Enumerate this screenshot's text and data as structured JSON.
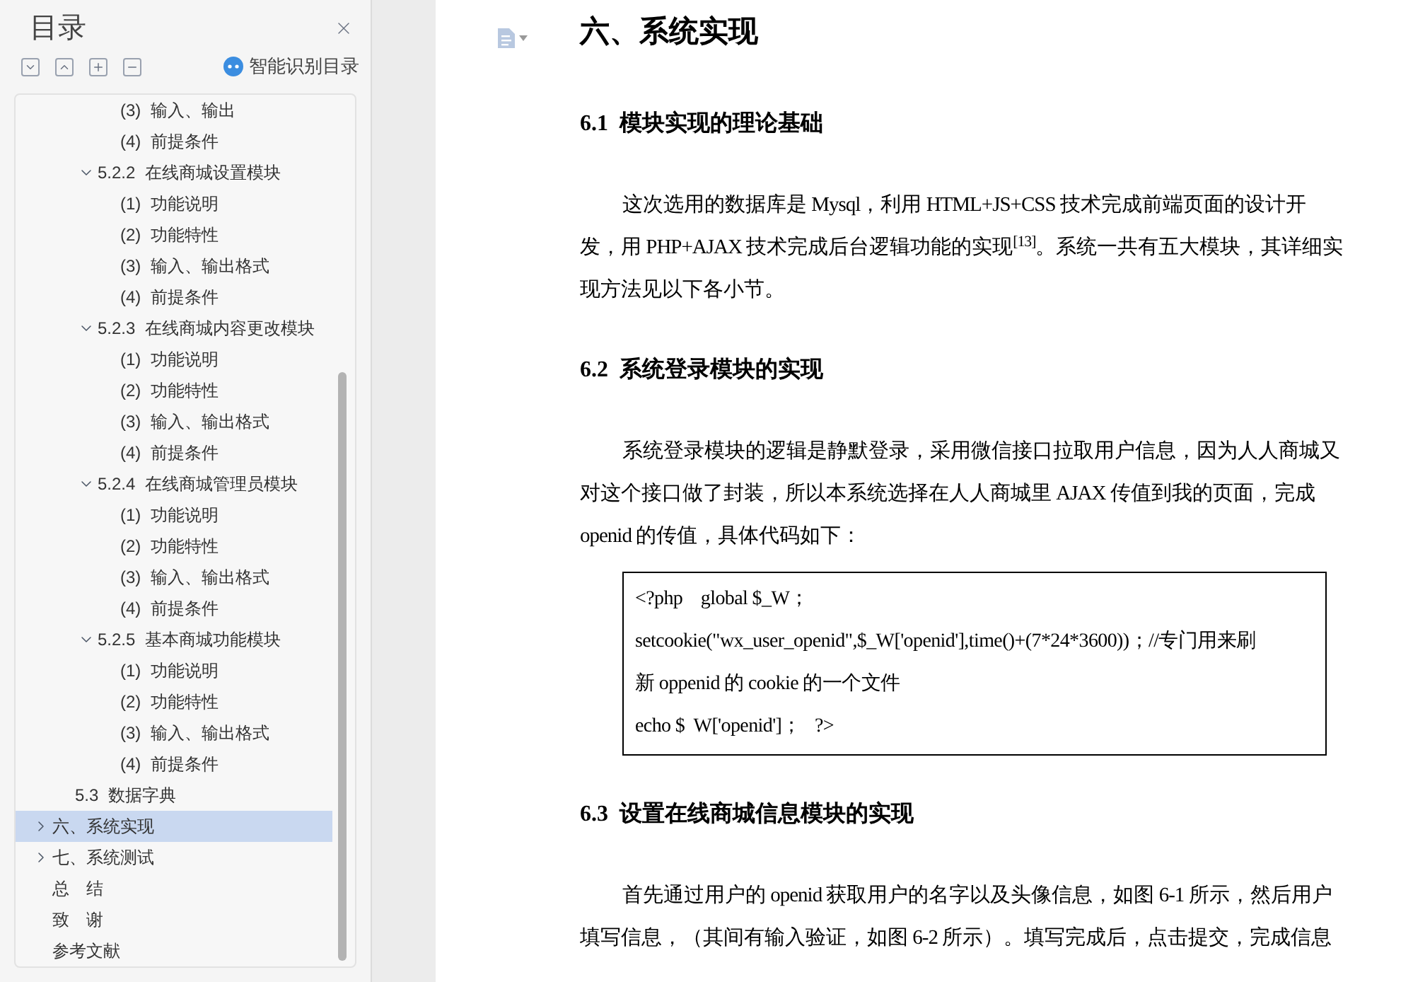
{
  "sidebar": {
    "title": "目录",
    "smart_toc_button": "智能识别目录",
    "toc": [
      {
        "children": [
          {
            "children": [
              {
                "children": [
                  {
                    "label": "(3)  输入、输出",
                    "selected": false
                  },
                  {
                    "label": "(4)  前提条件",
                    "selected": false
                  }
                ]
              },
              {
                "label": "5.2.2  在线商城设置模块",
                "expanded": true,
                "selected": false,
                "children": [
                  {
                    "label": "(1)  功能说明",
                    "selected": false
                  },
                  {
                    "label": "(2)  功能特性",
                    "selected": false
                  },
                  {
                    "label": "(3)  输入、输出格式",
                    "selected": false
                  },
                  {
                    "label": "(4)  前提条件",
                    "selected": false
                  }
                ]
              },
              {
                "label": "5.2.3  在线商城内容更改模块",
                "expanded": true,
                "selected": false,
                "children": [
                  {
                    "label": "(1)  功能说明",
                    "selected": false
                  },
                  {
                    "label": "(2)  功能特性",
                    "selected": false
                  },
                  {
                    "label": "(3)  输入、输出格式",
                    "selected": false
                  },
                  {
                    "label": "(4)  前提条件",
                    "selected": false
                  }
                ]
              },
              {
                "label": "5.2.4  在线商城管理员模块",
                "expanded": true,
                "selected": false,
                "children": [
                  {
                    "label": "(1)  功能说明",
                    "selected": false
                  },
                  {
                    "label": "(2)  功能特性",
                    "selected": false
                  },
                  {
                    "label": "(3)  输入、输出格式",
                    "selected": false
                  },
                  {
                    "label": "(4)  前提条件",
                    "selected": false
                  }
                ]
              },
              {
                "label": "5.2.5  基本商城功能模块",
                "expanded": true,
                "selected": false,
                "children": [
                  {
                    "label": "(1)  功能说明",
                    "selected": false
                  },
                  {
                    "label": "(2)  功能特性",
                    "selected": false
                  },
                  {
                    "label": "(3)  输入、输出格式",
                    "selected": false
                  },
                  {
                    "label": "(4)  前提条件",
                    "selected": false
                  }
                ]
              }
            ]
          },
          {
            "label": "5.3  数据字典",
            "selected": false
          }
        ]
      },
      {
        "label": "六、系统实现",
        "expanded": false,
        "selected": true
      },
      {
        "label": "七、系统测试",
        "expanded": false,
        "selected": false
      },
      {
        "label": "总　结",
        "selected": false
      },
      {
        "label": "致　谢",
        "selected": false
      },
      {
        "label": "参考文献",
        "selected": false
      }
    ]
  },
  "document": {
    "blocks": [
      {
        "kind": "h1",
        "text": "六、系统实现"
      },
      {
        "kind": "h2",
        "text": "6.1  模块实现的理论基础"
      },
      {
        "kind": "paragraph",
        "text": "这次选用的数据库是 Mysql，利用 HTML+JS+CSS 技术完成前端页面的设计开发，用 PHP+AJAX 技术完成后台逻辑功能的实现$^{[13]}$。系统一共有五大模块，其详细实现方法见以下各小节。"
      },
      {
        "kind": "h2",
        "text": "6.2  系统登录模块的实现"
      },
      {
        "kind": "paragraph",
        "text": "系统登录模块的逻辑是静默登录，采用微信接口拉取用户信息，因为人人商城又对这个接口做了封装，所以本系统选择在人人商城里 AJAX 传值到我的页面，完成 openid 的传值，具体代码如下："
      },
      {
        "kind": "code",
        "lines": [
          "<?php    global $_W；",
          "setcookie(\"wx_user_openid\",$_W['openid'],time()+(7*24*3600))；//专门用来刷",
          "新 oppenid 的 cookie 的一个文件",
          "echo $  W['openid']；   ?>"
        ]
      },
      {
        "kind": "h2",
        "text": "6.3  设置在线商城信息模块的实现"
      },
      {
        "kind": "paragraph",
        "text": "首先通过用户的 openid 获取用户的名字以及头像信息，如图 6-1 所示，然后用户填写信息，（其间有输入验证，如图 6-2 所示）。填写完成后，点击提交，完成信息"
      }
    ]
  }
}
